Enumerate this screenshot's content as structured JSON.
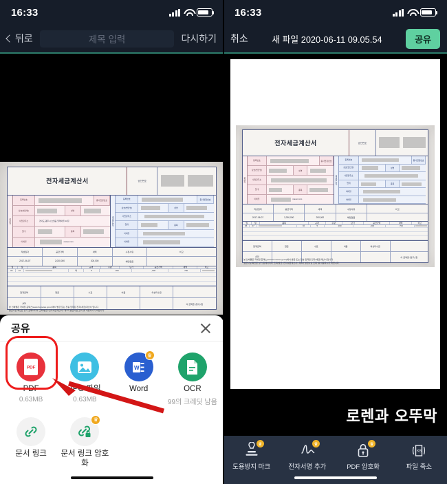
{
  "left_phone": {
    "status": {
      "time": "16:33",
      "signal_icon": "cellular-bars-icon",
      "wifi_icon": "wifi-icon",
      "battery_icon": "battery-icon"
    },
    "nav": {
      "back_label": "뒤로",
      "title_placeholder": "제목 입력",
      "title_value": "",
      "redo_label": "다시하기"
    },
    "share_sheet": {
      "title": "공유",
      "close_icon": "close-icon",
      "items": [
        {
          "label": "PDF",
          "sub": "0.63MB",
          "icon": "pdf-file-icon",
          "color": "#e8323c",
          "premium": false,
          "highlighted": true
        },
        {
          "label": "JPG 파일",
          "sub": "0.63MB",
          "icon": "image-file-icon",
          "color": "#3ebfe3",
          "premium": false,
          "highlighted": false
        },
        {
          "label": "Word",
          "sub": "",
          "icon": "word-file-icon",
          "color": "#2a5fd0",
          "premium": true,
          "highlighted": false
        },
        {
          "label": "OCR",
          "sub": "99의 크레딧 남음",
          "icon": "ocr-document-icon",
          "color": "#1fa36b",
          "premium": false,
          "highlighted": false
        },
        {
          "label": "문서 링크",
          "sub": "",
          "icon": "link-icon",
          "color": "#f2f2f2",
          "premium": false,
          "highlighted": false
        },
        {
          "label": "문서 링크 암호화",
          "sub": "",
          "icon": "link-lock-icon",
          "color": "#f2f2f2",
          "premium": true,
          "highlighted": false
        }
      ]
    },
    "annotation": {
      "highlight_color": "#ee1c1c",
      "arrow_color": "#d31616",
      "target": "PDF"
    }
  },
  "right_phone": {
    "status": {
      "time": "16:33",
      "signal_icon": "cellular-bars-icon",
      "wifi_icon": "wifi-icon",
      "battery_icon": "battery-icon"
    },
    "nav": {
      "cancel_label": "취소",
      "title": "새 파일 2020-06-11 09.05.54",
      "share_label": "공유",
      "share_color": "#5fd0a0"
    },
    "watermark_text": "로렌과 오뚜막",
    "toolbar": [
      {
        "label": "도용방지 마크",
        "icon": "stamp-icon",
        "premium": true
      },
      {
        "label": "전자서명 추가",
        "icon": "signature-icon",
        "premium": true
      },
      {
        "label": "PDF 암호화",
        "icon": "lock-icon",
        "premium": true
      },
      {
        "label": "파일 축소",
        "icon": "compress-kb-icon",
        "premium": false
      }
    ]
  },
  "document": {
    "title": "전자세금계산서",
    "approval_label": "승인번호",
    "supplier_tab": "공급자",
    "buyer_tab": "공급받는자",
    "supplier_rows": [
      {
        "label": "등록번호",
        "label2": "종사업장번호"
      },
      {
        "label": "상호(법인명)",
        "label2": "성명"
      },
      {
        "label": "사업장주소",
        "label2": ""
      },
      {
        "label": "업태",
        "label2": "종목"
      },
      {
        "label": "이메일",
        "label2": ""
      }
    ],
    "buyer_rows": [
      {
        "label": "등록번호",
        "label2": "종사업장번호"
      },
      {
        "label": "상호(법인명)",
        "label2": "성명"
      },
      {
        "label": "사업장주소",
        "label2": ""
      },
      {
        "label": "업태",
        "label2": "종목"
      },
      {
        "label": "이메일",
        "label2": ""
      },
      {
        "label": "이메일",
        "label2": ""
      }
    ],
    "summary_headers": [
      "작성일자",
      "공급가액",
      "세액",
      "수정사유",
      "비고"
    ],
    "summary_values": [
      "2017-06-07",
      "2,000,000",
      "200,000",
      "해당없음",
      ""
    ],
    "item_headers": [
      "월",
      "일",
      "품목",
      "규격",
      "수량",
      "단가",
      "공급가액",
      "세액",
      "비고"
    ],
    "item_row": [
      "06",
      "07",
      "",
      "박",
      "5",
      "200",
      ",000",
      "700",
      ""
    ],
    "total_headers": [
      "합계금액",
      "현금",
      "수표",
      "어음",
      "외상미수금"
    ],
    "total_value": ",000",
    "receipt_note": "이 금액을 (청구) 함",
    "address_text": "경기도 광주시 초월읍 밀래마을 10길",
    "email_text": "maver.com",
    "footer_line1": "본 인쇄물은 국세청 홈택스(www.hometax.go.kr)에서 발급 또는 전송 입력된 전자(세금)계산서 입니다.",
    "footer_line2": "발급사실 확인은 상기 홈페이지의 '조회/발급>전자세금계산서> 제3자 발급사실 조회' 를 이용하시기 바랍니다."
  }
}
